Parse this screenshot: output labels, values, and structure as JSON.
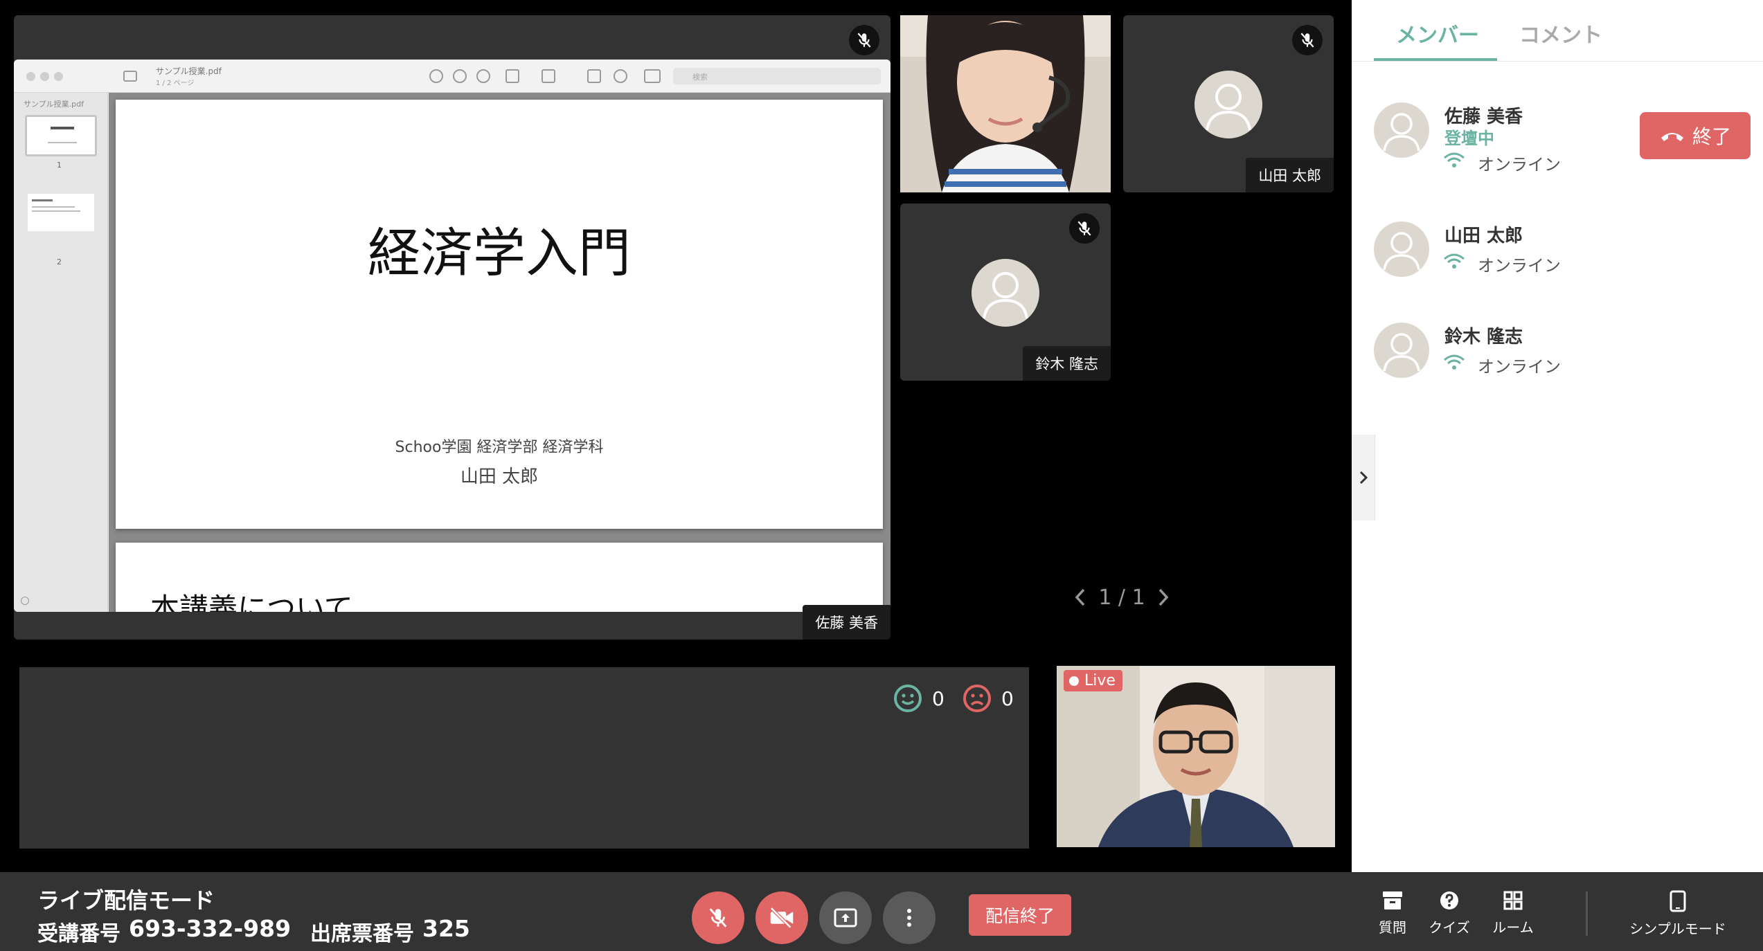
{
  "pdf": {
    "filename": "サンプル授業.pdf",
    "page_info": "1 / 2 ページ",
    "sidebar_title": "サンプル授業.pdf",
    "search_placeholder": "検索",
    "thumbnails": [
      {
        "num": "1"
      },
      {
        "num": "2"
      }
    ],
    "slide1_title": "経済学入門",
    "slide1_org": "Schoo学園 経済学部 経済学科",
    "slide1_author": "山田 太郎",
    "slide2_title_partial": "本講義について"
  },
  "participants": {
    "presenter_name": "佐藤 美香",
    "tile_yamada": "山田 太郎",
    "tile_suzuki": "鈴木 隆志"
  },
  "pagination": "1 / 1",
  "reactions": {
    "positive_count": "0",
    "negative_count": "0"
  },
  "live": {
    "badge": "Live"
  },
  "panel": {
    "tabs": [
      {
        "label": "メンバー",
        "active": true
      },
      {
        "label": "コメント",
        "active": false
      }
    ],
    "end_button": "終了",
    "members": [
      {
        "name": "佐藤 美香",
        "role": "登壇中",
        "status": "オンライン"
      },
      {
        "name": "山田 太郎",
        "status": "オンライン"
      },
      {
        "name": "鈴木 隆志",
        "status": "オンライン"
      }
    ]
  },
  "bottombar": {
    "mode_label": "ライブ配信モード",
    "course_label": "受講番号",
    "course_number": "693-332-989",
    "attendance_label": "出席票番号",
    "attendance_number": "325",
    "end_stream": "配信終了",
    "tools": [
      {
        "label": "質問"
      },
      {
        "label": "クイズ"
      },
      {
        "label": "ルーム"
      }
    ],
    "simple_mode": "シンプルモード"
  },
  "colors": {
    "accent": "#6bb3a2",
    "danger": "#e06666",
    "stage": "#333333"
  }
}
